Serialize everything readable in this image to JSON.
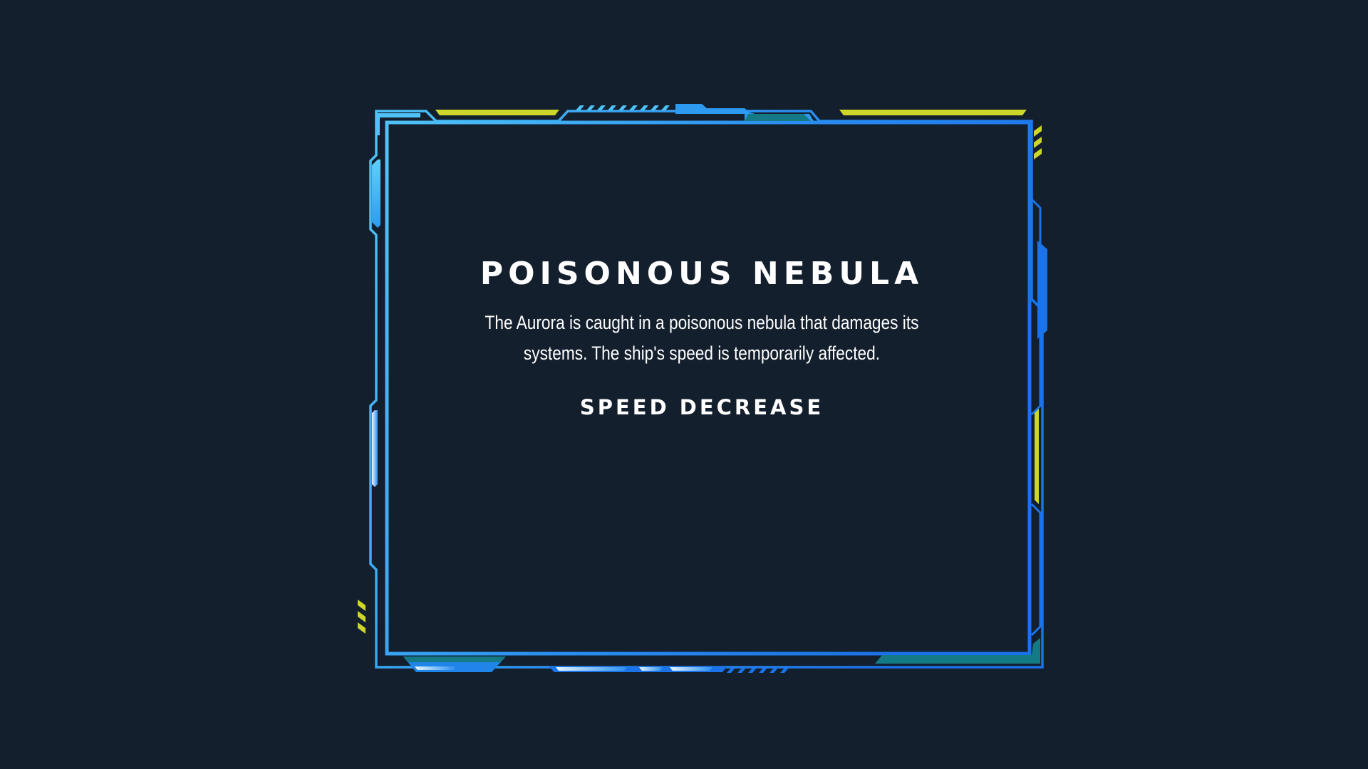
{
  "event": {
    "title": "POISONOUS NEBULA",
    "description": "The Aurora is caught in a poisonous nebula that damages its systems. The ship's speed is temporarily affected.",
    "effect": "SPEED DECREASE"
  },
  "colors": {
    "background": "#131f2d",
    "frame_light": "#4fc3f7",
    "frame_dark": "#1a73e8",
    "accent_yellow": "#cdd629",
    "accent_teal": "#137a86",
    "text": "#ffffff"
  }
}
